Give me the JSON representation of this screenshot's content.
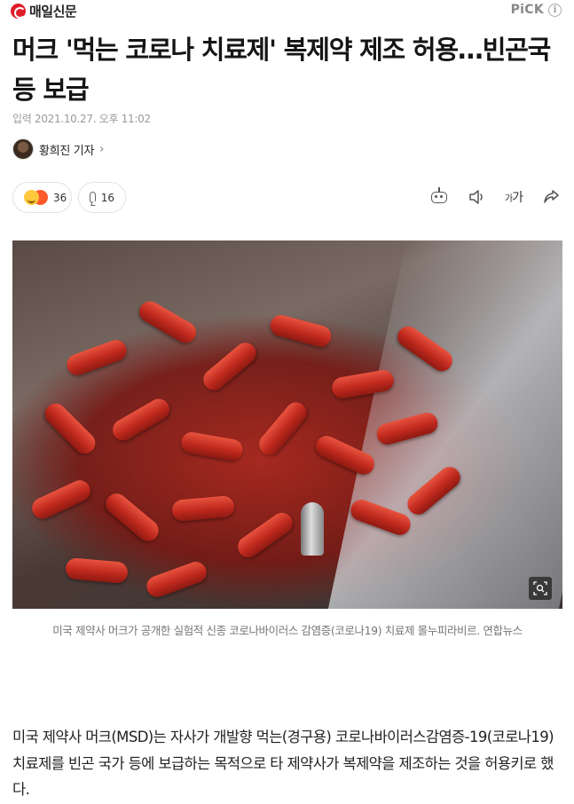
{
  "press": {
    "name": "매일신문"
  },
  "pick": {
    "label": "PiCK",
    "info": "i"
  },
  "headline": "머크 '먹는 코로나 치료제' 복제약 제조 허용…빈곤국 등 보급",
  "dateline": "입력 2021.10.27. 오후 11:02",
  "reporter": {
    "name": "황희진 기자",
    "chevron": "›"
  },
  "reactions": {
    "count": "36"
  },
  "comments": {
    "count": "16"
  },
  "tools": {
    "font_label_small": "가",
    "font_label_large": "가"
  },
  "photo": {
    "caption": "미국 제약사 머크가 공개한 실험적 신종 코로나바이러스 감염증(코로나19) 치료제 몰누피라비르. 연합뉴스"
  },
  "body": "미국 제약사 머크(MSD)는 자사가 개발향 먹는(경구용) 코로나바이러스감염증-19(코로나19) 치료제를 빈곤 국가 등에 보급하는 목적으로 타 제약사가 복제약을 제조하는 것을 허용키로 했다."
}
